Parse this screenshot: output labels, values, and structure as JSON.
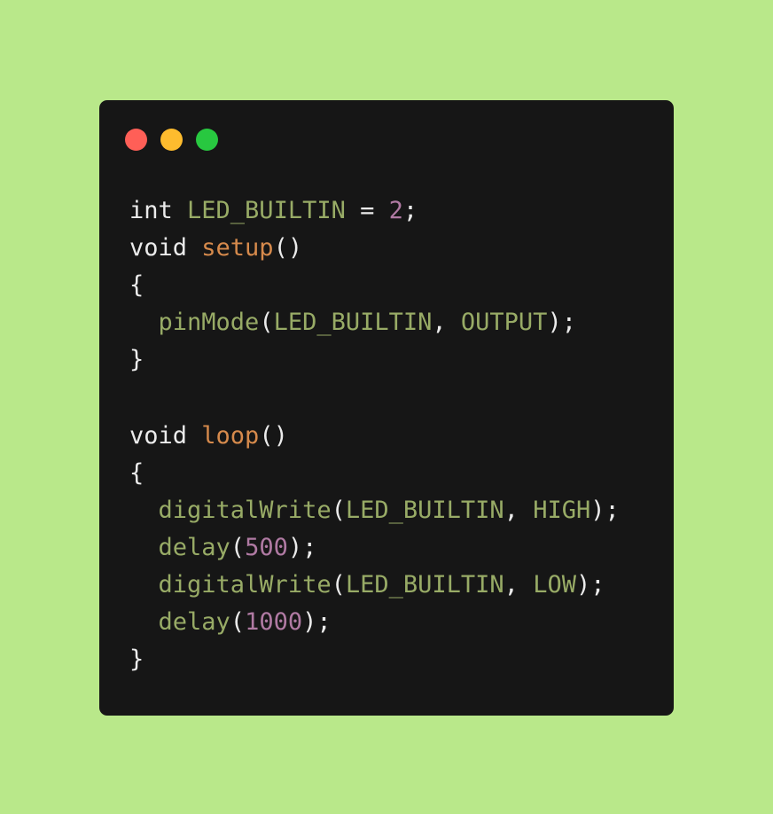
{
  "colors": {
    "background": "#b9e88a",
    "window": "#161616",
    "dot_close": "#ff5f57",
    "dot_minimize": "#febc2e",
    "dot_maximize": "#28c840",
    "plain": "#ebebeb",
    "identifier": "#98ab66",
    "function_decl": "#d68a4c",
    "number": "#b07aa3"
  },
  "window_controls": [
    "close-dot",
    "minimize-dot",
    "maximize-dot"
  ],
  "code_lines": [
    [
      {
        "text": "int ",
        "kind": "plain"
      },
      {
        "text": "LED_BUILTIN",
        "kind": "identifier"
      },
      {
        "text": " = ",
        "kind": "plain"
      },
      {
        "text": "2",
        "kind": "number"
      },
      {
        "text": ";",
        "kind": "plain"
      }
    ],
    [
      {
        "text": "void ",
        "kind": "plain"
      },
      {
        "text": "setup",
        "kind": "function_decl"
      },
      {
        "text": "()",
        "kind": "plain"
      }
    ],
    [
      {
        "text": "{",
        "kind": "plain"
      }
    ],
    [
      {
        "text": "  ",
        "kind": "plain"
      },
      {
        "text": "pinMode",
        "kind": "identifier"
      },
      {
        "text": "(",
        "kind": "plain"
      },
      {
        "text": "LED_BUILTIN",
        "kind": "identifier"
      },
      {
        "text": ", ",
        "kind": "plain"
      },
      {
        "text": "OUTPUT",
        "kind": "identifier"
      },
      {
        "text": ");",
        "kind": "plain"
      }
    ],
    [
      {
        "text": "}",
        "kind": "plain"
      }
    ],
    [],
    [
      {
        "text": "void ",
        "kind": "plain"
      },
      {
        "text": "loop",
        "kind": "function_decl"
      },
      {
        "text": "()",
        "kind": "plain"
      }
    ],
    [
      {
        "text": "{",
        "kind": "plain"
      }
    ],
    [
      {
        "text": "  ",
        "kind": "plain"
      },
      {
        "text": "digitalWrite",
        "kind": "identifier"
      },
      {
        "text": "(",
        "kind": "plain"
      },
      {
        "text": "LED_BUILTIN",
        "kind": "identifier"
      },
      {
        "text": ", ",
        "kind": "plain"
      },
      {
        "text": "HIGH",
        "kind": "identifier"
      },
      {
        "text": ");",
        "kind": "plain"
      }
    ],
    [
      {
        "text": "  ",
        "kind": "plain"
      },
      {
        "text": "delay",
        "kind": "identifier"
      },
      {
        "text": "(",
        "kind": "plain"
      },
      {
        "text": "500",
        "kind": "number"
      },
      {
        "text": ");",
        "kind": "plain"
      }
    ],
    [
      {
        "text": "  ",
        "kind": "plain"
      },
      {
        "text": "digitalWrite",
        "kind": "identifier"
      },
      {
        "text": "(",
        "kind": "plain"
      },
      {
        "text": "LED_BUILTIN",
        "kind": "identifier"
      },
      {
        "text": ", ",
        "kind": "plain"
      },
      {
        "text": "LOW",
        "kind": "identifier"
      },
      {
        "text": ");",
        "kind": "plain"
      }
    ],
    [
      {
        "text": "  ",
        "kind": "plain"
      },
      {
        "text": "delay",
        "kind": "identifier"
      },
      {
        "text": "(",
        "kind": "plain"
      },
      {
        "text": "1000",
        "kind": "number"
      },
      {
        "text": ");",
        "kind": "plain"
      }
    ],
    [
      {
        "text": "}",
        "kind": "plain"
      }
    ]
  ]
}
